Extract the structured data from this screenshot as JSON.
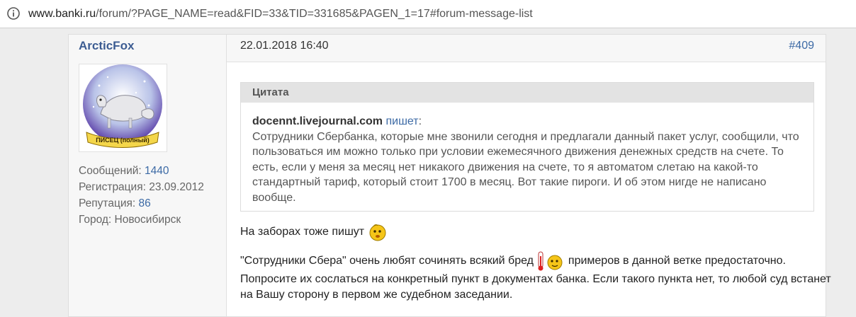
{
  "browser": {
    "url_host": "www.banki.ru",
    "url_path": "/forum/?PAGE_NAME=read&FID=33&TID=331685&PAGEN_1=17#forum-message-list"
  },
  "post": {
    "author": {
      "name": "ArcticFox",
      "avatar_caption": "ПИСЕЦ (полный)",
      "stats": [
        {
          "label": "Сообщений:",
          "value": "1440",
          "link": true
        },
        {
          "label": "Регистрация:",
          "value": "23.09.2012",
          "link": false
        },
        {
          "label": "Репутация:",
          "value": "86",
          "link": true
        },
        {
          "label": "Город:",
          "value": "Новосибирск",
          "link": false
        }
      ]
    },
    "date": "22.01.2018 16:40",
    "number": "#409",
    "quote": {
      "title": "Цитата",
      "author": "docennt.livejournal.com",
      "writes": "пишет",
      "text": "Сотрудники Сбербанка, которые мне звонили сегодня и предлагали данный пакет услуг, сообщили, что пользоваться им можно только при условии ежемесячного движения денежных средств на счете. То есть, если у меня за месяц нет никакого движения на счете, то я автоматом слетаю на какой-то стандартный тариф, который стоит 1700 в месяц. Вот такие пироги. И об этом нигде не написано вообще."
    },
    "paragraph1": "На заборах тоже пишут",
    "paragraph2_start": "\"Сотрудники Сбера\" очень любят сочинять всякий бред",
    "paragraph2_end": "примеров в данной ветке предостаточно. Попросите их сослаться на конкретный пункт в документах банка. Если такого пункта нет, то любой суд встанет на Вашу сторону в первом же судебном заседании.",
    "smiley1": "wondering-smiley-icon",
    "smiley2": "thermometer-smiley-icon"
  }
}
